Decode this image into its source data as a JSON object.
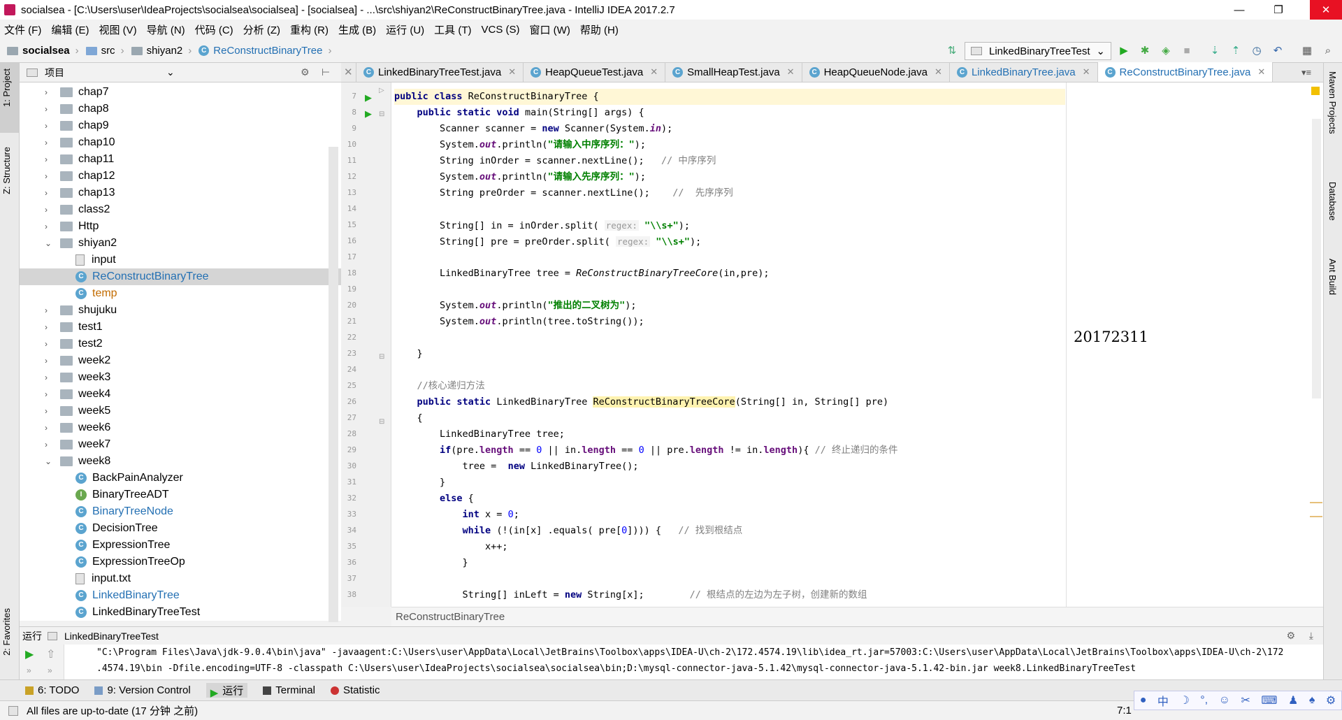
{
  "window": {
    "title": "socialsea - [C:\\Users\\user\\IdeaProjects\\socialsea\\socialsea] - [socialsea] - ...\\src\\shiyan2\\ReConstructBinaryTree.java - IntelliJ IDEA 2017.2.7",
    "minimize": "—",
    "restore": "❐",
    "close": "✕"
  },
  "menu": [
    "文件 (F)",
    "编辑 (E)",
    "视图 (V)",
    "导航 (N)",
    "代码 (C)",
    "分析 (Z)",
    "重构 (R)",
    "生成 (B)",
    "运行 (U)",
    "工具 (T)",
    "VCS (S)",
    "窗口 (W)",
    "帮助 (H)"
  ],
  "breadcrumb": {
    "project": "socialsea",
    "src": "src",
    "pkg": "shiyan2",
    "file": "ReConstructBinaryTree"
  },
  "toolbar": {
    "run_config": "LinkedBinaryTreeTest"
  },
  "side": {
    "project": "1: Project",
    "structure": "Z: Structure",
    "favorites": "2: Favorites",
    "maven": "Maven Projects",
    "database": "Database",
    "ant": "Ant Build"
  },
  "project_panel": {
    "label": "项目"
  },
  "tree": [
    {
      "label": "chap7",
      "type": "folder",
      "level": 1,
      "arrow": "›"
    },
    {
      "label": "chap8",
      "type": "folder",
      "level": 1,
      "arrow": "›"
    },
    {
      "label": "chap9",
      "type": "folder",
      "level": 1,
      "arrow": "›"
    },
    {
      "label": "chap10",
      "type": "folder",
      "level": 1,
      "arrow": "›"
    },
    {
      "label": "chap11",
      "type": "folder",
      "level": 1,
      "arrow": "›"
    },
    {
      "label": "chap12",
      "type": "folder",
      "level": 1,
      "arrow": "›"
    },
    {
      "label": "chap13",
      "type": "folder",
      "level": 1,
      "arrow": "›"
    },
    {
      "label": "class2",
      "type": "folder",
      "level": 1,
      "arrow": "›"
    },
    {
      "label": "Http",
      "type": "folder",
      "level": 1,
      "arrow": "›"
    },
    {
      "label": "shiyan2",
      "type": "folder",
      "level": 1,
      "arrow": "⌄"
    },
    {
      "label": "input",
      "type": "file",
      "level": 2
    },
    {
      "label": "ReConstructBinaryTree",
      "type": "class",
      "level": 2,
      "color": "#2470b3",
      "selected": true
    },
    {
      "label": "temp",
      "type": "class",
      "level": 2,
      "color": "#c26b00"
    },
    {
      "label": "shujuku",
      "type": "folder",
      "level": 1,
      "arrow": "›"
    },
    {
      "label": "test1",
      "type": "folder",
      "level": 1,
      "arrow": "›"
    },
    {
      "label": "test2",
      "type": "folder",
      "level": 1,
      "arrow": "›"
    },
    {
      "label": "week2",
      "type": "folder",
      "level": 1,
      "arrow": "›"
    },
    {
      "label": "week3",
      "type": "folder",
      "level": 1,
      "arrow": "›"
    },
    {
      "label": "week4",
      "type": "folder",
      "level": 1,
      "arrow": "›"
    },
    {
      "label": "week5",
      "type": "folder",
      "level": 1,
      "arrow": "›"
    },
    {
      "label": "week6",
      "type": "folder",
      "level": 1,
      "arrow": "›"
    },
    {
      "label": "week7",
      "type": "folder",
      "level": 1,
      "arrow": "›"
    },
    {
      "label": "week8",
      "type": "folder",
      "level": 1,
      "arrow": "⌄"
    },
    {
      "label": "BackPainAnalyzer",
      "type": "class",
      "level": 2
    },
    {
      "label": "BinaryTreeADT",
      "type": "interface",
      "level": 2
    },
    {
      "label": "BinaryTreeNode",
      "type": "class",
      "level": 2,
      "color": "#2470b3"
    },
    {
      "label": "DecisionTree",
      "type": "class",
      "level": 2
    },
    {
      "label": "ExpressionTree",
      "type": "class",
      "level": 2
    },
    {
      "label": "ExpressionTreeOp",
      "type": "class",
      "level": 2
    },
    {
      "label": "input.txt",
      "type": "file",
      "level": 2
    },
    {
      "label": "LinkedBinaryTree",
      "type": "class",
      "level": 2,
      "color": "#2470b3"
    },
    {
      "label": "LinkedBinaryTreeTest",
      "type": "class",
      "level": 2
    }
  ],
  "tabs": [
    {
      "label": "LinkedBinaryTreeTest.java",
      "active": false
    },
    {
      "label": "HeapQueueTest.java",
      "active": false
    },
    {
      "label": "SmallHeapTest.java",
      "active": false
    },
    {
      "label": "HeapQueueNode.java",
      "active": false
    },
    {
      "label": "LinkedBinaryTree.java",
      "active": false,
      "color": "#2470b3"
    },
    {
      "label": "ReConstructBinaryTree.java",
      "active": true
    }
  ],
  "line_numbers": [
    "7",
    "8",
    "9",
    "10",
    "11",
    "12",
    "13",
    "14",
    "15",
    "16",
    "17",
    "18",
    "19",
    "20",
    "21",
    "22",
    "23",
    "24",
    "25",
    "26",
    "27",
    "28",
    "29",
    "30",
    "31",
    "32",
    "33",
    "34",
    "35",
    "36",
    "37",
    "38"
  ],
  "code": {
    "l7": {
      "a": "public class ",
      "b": "ReConstructBinaryTree {"
    },
    "l8": {
      "a": "    public static void ",
      "b": "main(String[] args) {"
    },
    "l9": {
      "a": "        Scanner scanner = ",
      "k": "new ",
      "b": "Scanner(System.",
      "f": "in",
      "c": ");"
    },
    "l10": {
      "a": "        System.",
      "f": "out",
      "b": ".println(",
      "s": "\"请输入中序序列：\"",
      "c": ");"
    },
    "l11": {
      "a": "        String inOrder = scanner.nextLine();   ",
      "m": "// 中序序列"
    },
    "l12": {
      "a": "        System.",
      "f": "out",
      "b": ".println(",
      "s": "\"请输入先序序列：\"",
      "c": ");"
    },
    "l13": {
      "a": "        String preOrder = scanner.nextLine();    ",
      "m": "//  先序序列"
    },
    "l15": {
      "a": "        String[] in = inOrder.split( ",
      "h": "regex:",
      "s": " \"\\\\s+\"",
      "c": ");"
    },
    "l16": {
      "a": "        String[] pre = preOrder.split( ",
      "h": "regex:",
      "s": " \"\\\\s+\"",
      "c": ");"
    },
    "l18": {
      "a": "        LinkedBinaryTree tree = ",
      "i": "ReConstructBinaryTreeCore",
      "c": "(in,pre);"
    },
    "l20": {
      "a": "        System.",
      "f": "out",
      "b": ".println(",
      "s": "\"推出的二叉树为\"",
      "c": ");"
    },
    "l21": {
      "a": "        System.",
      "f": "out",
      "b": ".println(tree.toString());"
    },
    "l23": {
      "a": "    }"
    },
    "l25": {
      "m": "    //核心递归方法"
    },
    "l26": {
      "k": "    public static ",
      "a": "LinkedBinaryTree ",
      "y": "ReConstructBinaryTreeCore",
      "c": "(String[] in, String[] pre)"
    },
    "l27": {
      "a": "    {"
    },
    "l28": {
      "a": "        LinkedBinaryTree tree;"
    },
    "l29": {
      "k": "        if",
      "a": "(pre.",
      "f1": "length",
      "b": " == ",
      "n": "0",
      "c": " || in.",
      "f2": "length",
      "d": " == ",
      "n2": "0",
      "e": " || pre.",
      "f3": "length",
      "g": " != in.",
      "f4": "length",
      "z": "){ ",
      "m": "// 终止递归的条件"
    },
    "l30": {
      "a": "            tree =  ",
      "k": "new ",
      "b": "LinkedBinaryTree();"
    },
    "l31": {
      "a": "        }"
    },
    "l32": {
      "k": "        else ",
      "a": "{"
    },
    "l33": {
      "k": "            int ",
      "a": "x = ",
      "n": "0",
      "c": ";"
    },
    "l34": {
      "k": "            while ",
      "a": "(!(in[x] .equals( pre[",
      "n": "0",
      "c": "]))) {   ",
      "m": "// 找到根结点"
    },
    "l35": {
      "a": "                x++;"
    },
    "l36": {
      "a": "            }"
    },
    "l38": {
      "a": "            String[] inLeft = ",
      "k": "new ",
      "b": "String[x];        ",
      "m": "// 根结点的左边为左子树，创建新的数组"
    }
  },
  "watermark": "20172311",
  "editor_status": "ReConstructBinaryTree",
  "run": {
    "label": "运行",
    "config": "LinkedBinaryTreeTest",
    "line1": "\"C:\\Program Files\\Java\\jdk-9.0.4\\bin\\java\" -javaagent:C:\\Users\\user\\AppData\\Local\\JetBrains\\Toolbox\\apps\\IDEA-U\\ch-2\\172.4574.19\\lib\\idea_rt.jar=57003:C:\\Users\\user\\AppData\\Local\\JetBrains\\Toolbox\\apps\\IDEA-U\\ch-2\\172",
    "line2": ".4574.19\\bin -Dfile.encoding=UTF-8 -classpath C:\\Users\\user\\IdeaProjects\\socialsea\\socialsea\\bin;D:\\mysql-connector-java-5.1.42\\mysql-connector-java-5.1.42-bin.jar week8.LinkedBinaryTreeTest"
  },
  "toolwindows": {
    "todo": "6: TODO",
    "vcs": "9: Version Control",
    "run": "运行",
    "terminal": "Terminal",
    "statistic": "Statistic"
  },
  "status": {
    "message": "All files are up-to-date (17 分钟 之前)",
    "position": "7:1"
  },
  "ime": {
    "lang": "中"
  }
}
